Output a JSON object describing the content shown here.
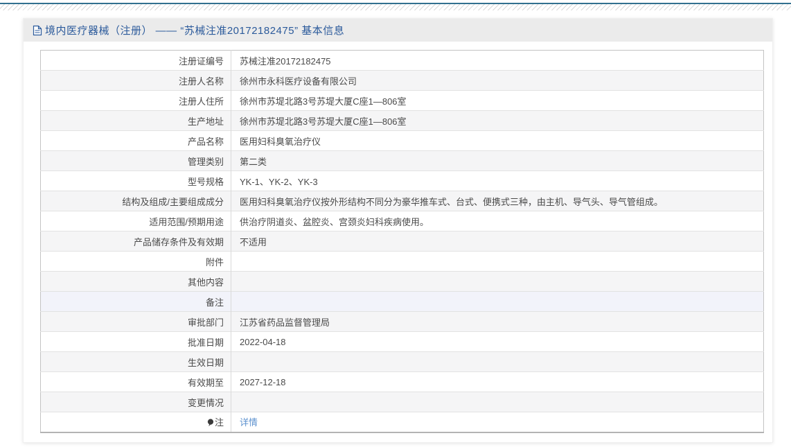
{
  "title_bar": {
    "icon": "document-icon",
    "title": "境内医疗器械（注册） —— “苏械注准20172182475” 基本信息"
  },
  "table": {
    "rows": [
      {
        "label": "注册证编号",
        "value": "苏械注准20172182475"
      },
      {
        "label": "注册人名称",
        "value": "徐州市永科医疗设备有限公司"
      },
      {
        "label": "注册人住所",
        "value": "徐州市苏堤北路3号苏堤大厦C座1—806室"
      },
      {
        "label": "生产地址",
        "value": "徐州市苏堤北路3号苏堤大厦C座1—806室"
      },
      {
        "label": "产品名称",
        "value": "医用妇科臭氧治疗仪"
      },
      {
        "label": "管理类别",
        "value": "第二类"
      },
      {
        "label": "型号规格",
        "value": "YK-1、YK-2、YK-3"
      },
      {
        "label": "结构及组成/主要组成成分",
        "value": "医用妇科臭氧治疗仪按外形结构不同分为豪华推车式、台式、便携式三种，由主机、导气头、导气管组成。"
      },
      {
        "label": "适用范围/预期用途",
        "value": "供治疗阴道炎、盆腔炎、宫颈炎妇科疾病使用。"
      },
      {
        "label": "产品储存条件及有效期",
        "value": "不适用"
      },
      {
        "label": "附件",
        "value": ""
      },
      {
        "label": "其他内容",
        "value": ""
      },
      {
        "label": "备注",
        "value": "",
        "highlight": true
      },
      {
        "label": "审批部门",
        "value": "江苏省药品监督管理局"
      },
      {
        "label": "批准日期",
        "value": "2022-04-18"
      },
      {
        "label": "生效日期",
        "value": ""
      },
      {
        "label": "有效期至",
        "value": "2027-12-18"
      },
      {
        "label": "变更情况",
        "value": ""
      },
      {
        "label": "注",
        "value": "详情",
        "label_icon": "balloon-icon",
        "link": true
      }
    ]
  },
  "colors": {
    "title_text": "#2b5a9b",
    "link": "#5d92cf",
    "title_bar_bg": "#ebebeb",
    "row_alt_bg": "#f5f5f6",
    "row_highlight_bg": "#f2f3fa",
    "table_border": "#c3c3c3",
    "top_rule": "#31708f"
  }
}
